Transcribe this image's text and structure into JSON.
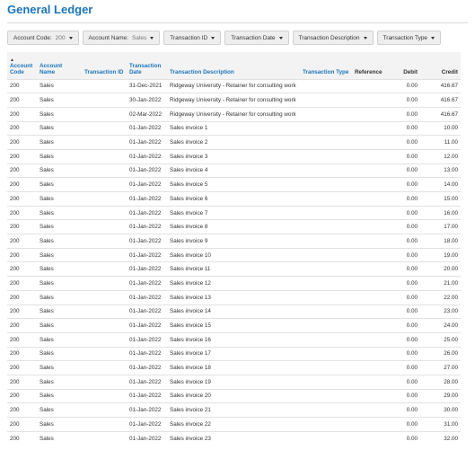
{
  "header": {
    "title": "General Ledger"
  },
  "filters": [
    {
      "label": "Account Code:",
      "value": "200"
    },
    {
      "label": "Account Name:",
      "value": "Sales"
    },
    {
      "label": "Transaction ID",
      "value": ""
    },
    {
      "label": "Transaction Date",
      "value": ""
    },
    {
      "label": "Transaction Description",
      "value": ""
    },
    {
      "label": "Transaction Type",
      "value": ""
    }
  ],
  "table": {
    "sort_indicator": "▲",
    "columns": {
      "account_code": "Account Code",
      "account_name": "Account Name",
      "transaction_id": "Transaction ID",
      "transaction_date": "Transaction Date",
      "description": "Transaction Description",
      "type": "Transaction Type",
      "reference": "Reference",
      "debit": "Debit",
      "credit": "Credit"
    },
    "rows": [
      [
        "200",
        "Sales",
        "",
        "31-Dec-2021",
        "Ridgeway University - Retainer for consulting work",
        "",
        "",
        "0.00",
        "416.67"
      ],
      [
        "200",
        "Sales",
        "",
        "30-Jan-2022",
        "Ridgeway University - Retainer for consulting work",
        "",
        "",
        "0.00",
        "416.67"
      ],
      [
        "200",
        "Sales",
        "",
        "02-Mar-2022",
        "Ridgeway University - Retainer for consulting work",
        "",
        "",
        "0.00",
        "416.67"
      ],
      [
        "200",
        "Sales",
        "",
        "01-Jan-2022",
        "Sales invoice 1",
        "",
        "",
        "0.00",
        "10.00"
      ],
      [
        "200",
        "Sales",
        "",
        "01-Jan-2022",
        "Sales invoice 2",
        "",
        "",
        "0.00",
        "11.00"
      ],
      [
        "200",
        "Sales",
        "",
        "01-Jan-2022",
        "Sales invoice 3",
        "",
        "",
        "0.00",
        "12.00"
      ],
      [
        "200",
        "Sales",
        "",
        "01-Jan-2022",
        "Sales invoice 4",
        "",
        "",
        "0.00",
        "13.00"
      ],
      [
        "200",
        "Sales",
        "",
        "01-Jan-2022",
        "Sales invoice 5",
        "",
        "",
        "0.00",
        "14.00"
      ],
      [
        "200",
        "Sales",
        "",
        "01-Jan-2022",
        "Sales invoice 6",
        "",
        "",
        "0.00",
        "15.00"
      ],
      [
        "200",
        "Sales",
        "",
        "01-Jan-2022",
        "Sales invoice 7",
        "",
        "",
        "0.00",
        "16.00"
      ],
      [
        "200",
        "Sales",
        "",
        "01-Jan-2022",
        "Sales invoice 8",
        "",
        "",
        "0.00",
        "17.00"
      ],
      [
        "200",
        "Sales",
        "",
        "01-Jan-2022",
        "Sales invoice 9",
        "",
        "",
        "0.00",
        "18.00"
      ],
      [
        "200",
        "Sales",
        "",
        "01-Jan-2022",
        "Sales invoice 10",
        "",
        "",
        "0.00",
        "19.00"
      ],
      [
        "200",
        "Sales",
        "",
        "01-Jan-2022",
        "Sales invoice 11",
        "",
        "",
        "0.00",
        "20.00"
      ],
      [
        "200",
        "Sales",
        "",
        "01-Jan-2022",
        "Sales invoice 12",
        "",
        "",
        "0.00",
        "21.00"
      ],
      [
        "200",
        "Sales",
        "",
        "01-Jan-2022",
        "Sales invoice 13",
        "",
        "",
        "0.00",
        "22.00"
      ],
      [
        "200",
        "Sales",
        "",
        "01-Jan-2022",
        "Sales invoice 14",
        "",
        "",
        "0.00",
        "23.00"
      ],
      [
        "200",
        "Sales",
        "",
        "01-Jan-2022",
        "Sales invoice 15",
        "",
        "",
        "0.00",
        "24.00"
      ],
      [
        "200",
        "Sales",
        "",
        "01-Jan-2022",
        "Sales invoice 16",
        "",
        "",
        "0.00",
        "25.00"
      ],
      [
        "200",
        "Sales",
        "",
        "01-Jan-2022",
        "Sales invoice 17",
        "",
        "",
        "0.00",
        "26.00"
      ],
      [
        "200",
        "Sales",
        "",
        "01-Jan-2022",
        "Sales invoice 18",
        "",
        "",
        "0.00",
        "27.00"
      ],
      [
        "200",
        "Sales",
        "",
        "01-Jan-2022",
        "Sales invoice 19",
        "",
        "",
        "0.00",
        "28.00"
      ],
      [
        "200",
        "Sales",
        "",
        "01-Jan-2022",
        "Sales invoice 20",
        "",
        "",
        "0.00",
        "29.00"
      ],
      [
        "200",
        "Sales",
        "",
        "01-Jan-2022",
        "Sales invoice 21",
        "",
        "",
        "0.00",
        "30.00"
      ],
      [
        "200",
        "Sales",
        "",
        "01-Jan-2022",
        "Sales invoice 22",
        "",
        "",
        "0.00",
        "31.00"
      ],
      [
        "200",
        "Sales",
        "",
        "01-Jan-2022",
        "Sales invoice 23",
        "",
        "",
        "0.00",
        "32.00"
      ]
    ]
  }
}
